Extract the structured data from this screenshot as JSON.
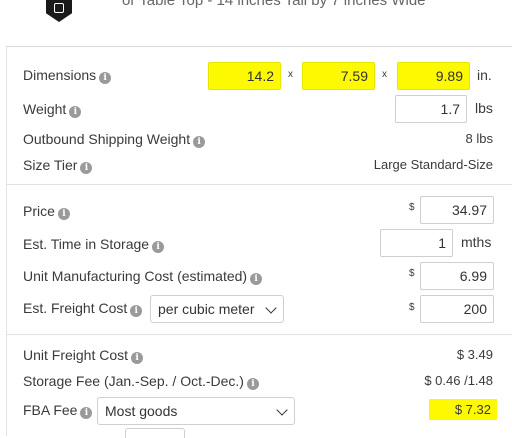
{
  "header": {
    "product_description": "or Table Top - 14 inches Tall by 7 inches Wide"
  },
  "rows": {
    "dimensions": {
      "label": "Dimensions",
      "length": "14.2",
      "width": "7.59",
      "height": "9.89",
      "separator": "x",
      "unit": "in."
    },
    "weight": {
      "label": "Weight",
      "value": "1.7",
      "unit": "lbs"
    },
    "outbound_weight": {
      "label": "Outbound Shipping Weight",
      "value": "8 lbs"
    },
    "size_tier": {
      "label": "Size Tier",
      "value": "Large Standard-Size"
    },
    "price": {
      "label": "Price",
      "currency": "$",
      "value": "34.97"
    },
    "storage_time": {
      "label": "Est. Time in Storage",
      "value": "1",
      "unit": "mths"
    },
    "manufacturing_cost": {
      "label": "Unit Manufacturing Cost (estimated)",
      "currency": "$",
      "value": "6.99"
    },
    "freight_cost": {
      "label": "Est. Freight Cost",
      "select_value": "per cubic meter",
      "currency": "$",
      "value": "200"
    },
    "unit_freight": {
      "label": "Unit Freight Cost",
      "value": "$ 3.49"
    },
    "storage_fee": {
      "label": "Storage Fee (Jan.-Sep. / Oct.-Dec.)",
      "value": "$ 0.46 /1.48"
    },
    "fba_fee": {
      "label": "FBA Fee",
      "select_value": "Most goods",
      "value": "$ 7.32"
    }
  },
  "colors": {
    "highlight": "#fdf900",
    "border": "#cfcfcf",
    "info_icon": "#9a9a9a"
  }
}
